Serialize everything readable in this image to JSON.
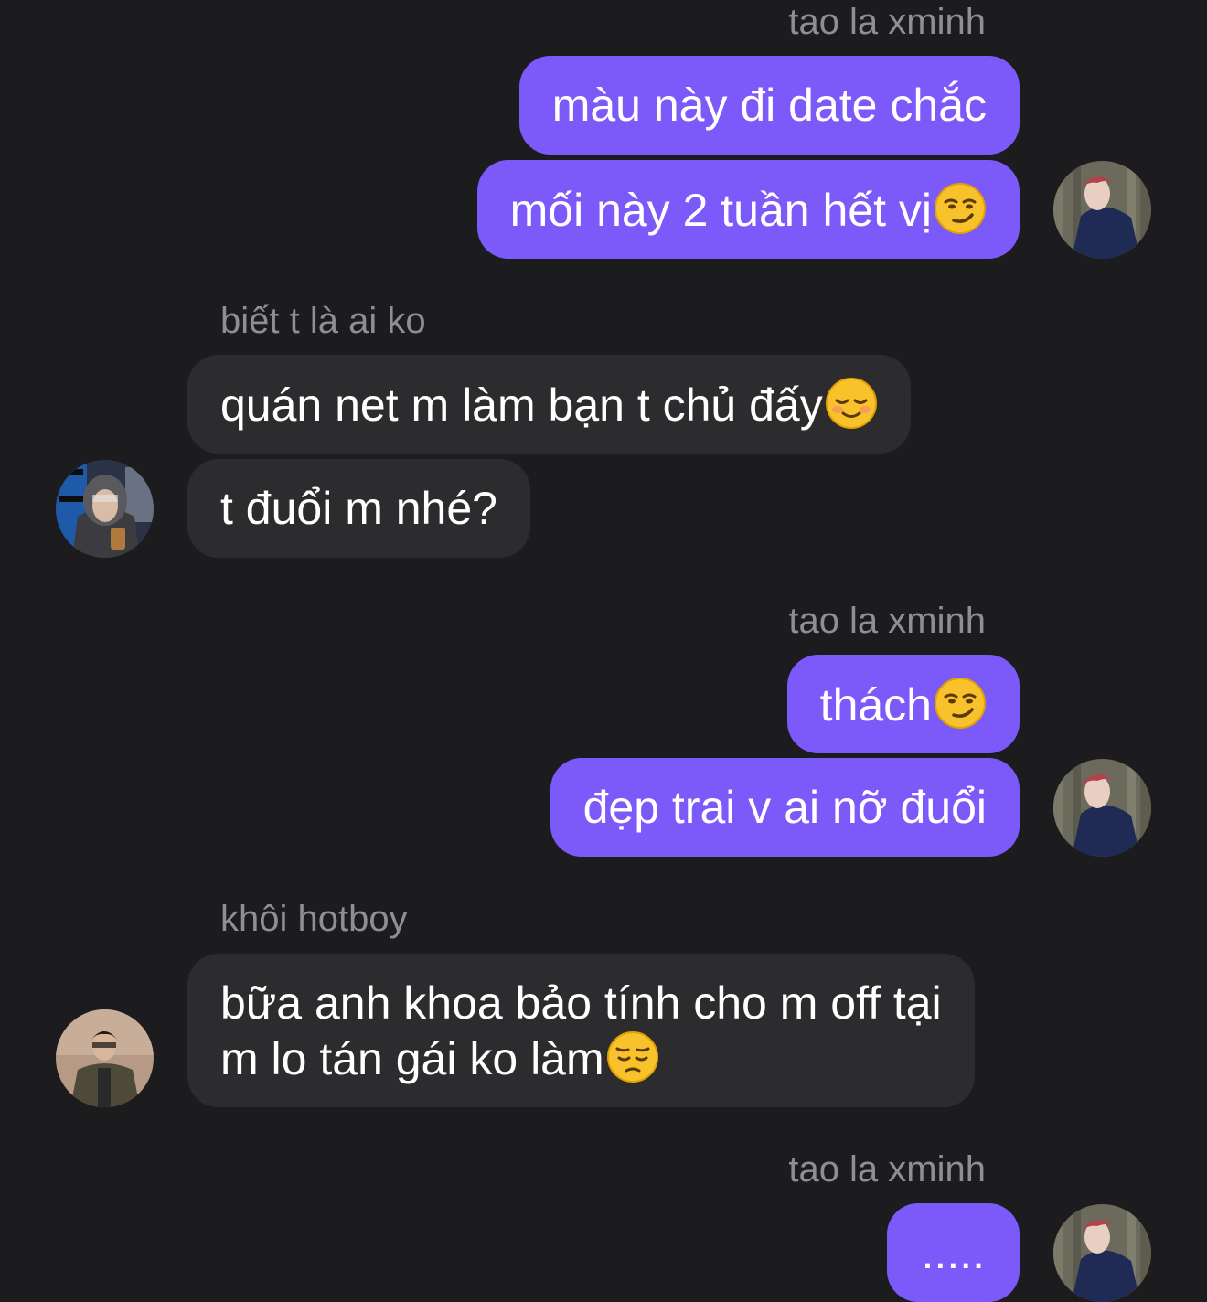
{
  "conversation": {
    "groups": [
      {
        "sender": "tao la xminh",
        "side": "outgoing",
        "messages": [
          {
            "text": "màu này đi date chắc",
            "emoji": ""
          },
          {
            "text": "mối này 2 tuần hết vị",
            "emoji": "smirking-face"
          }
        ]
      },
      {
        "sender": "biết t là ai ko",
        "side": "incoming",
        "messages": [
          {
            "text": "quán net m làm bạn t chủ đấy",
            "emoji": "smiling-face"
          },
          {
            "text": "t đuổi m nhé?",
            "emoji": ""
          }
        ]
      },
      {
        "sender": "tao la xminh",
        "side": "outgoing",
        "messages": [
          {
            "text": "thách",
            "emoji": "smirking-face"
          },
          {
            "text": "đẹp trai v ai nỡ đuổi",
            "emoji": ""
          }
        ]
      },
      {
        "sender": "khôi hotboy",
        "side": "incoming",
        "messages": [
          {
            "text": "bữa anh khoa bảo tính cho m off tại",
            "text_line2": "m lo tán gái ko làm",
            "emoji": "pensive-face"
          }
        ]
      },
      {
        "sender": "tao la xminh",
        "side": "outgoing",
        "messages": [
          {
            "text": ".....",
            "emoji": ""
          }
        ]
      }
    ]
  },
  "colors": {
    "background": "#1c1c1e",
    "outgoing_bubble": "#7b5af9",
    "incoming_bubble": "#2c2c2e",
    "sender_name": "#8e8e93"
  }
}
